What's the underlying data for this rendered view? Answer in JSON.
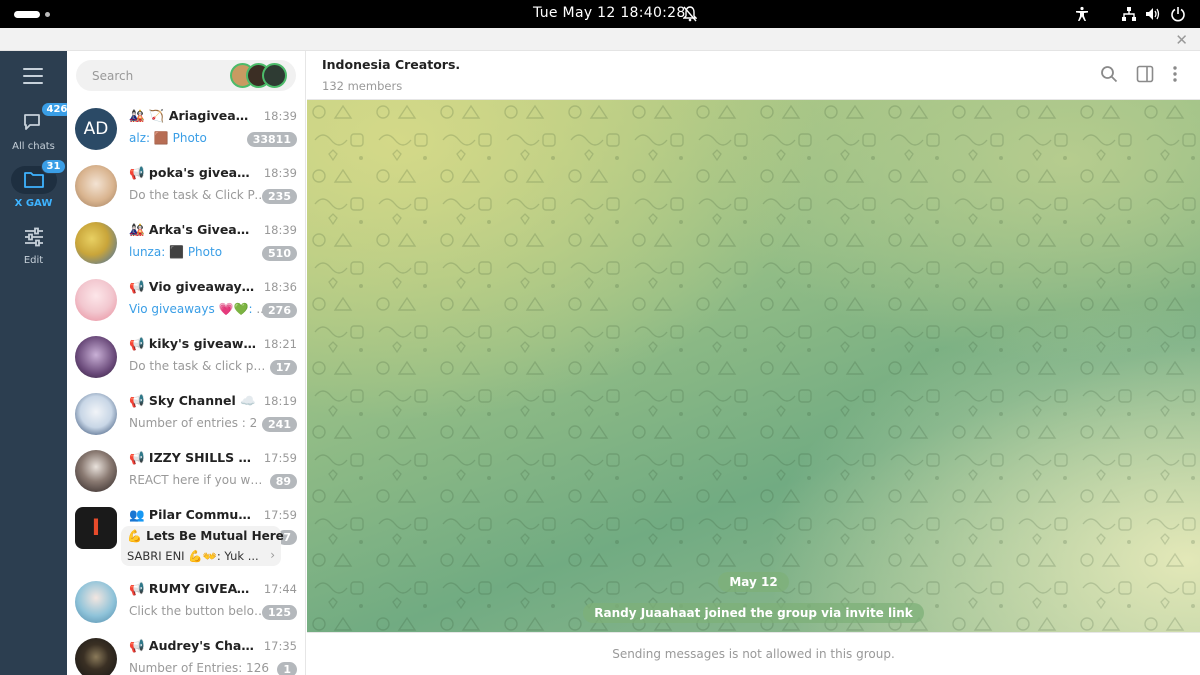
{
  "topbar": {
    "clock": "Tue May 12  18:40:28"
  },
  "rail": {
    "folders": [
      {
        "label": "All chats",
        "badge": "426"
      },
      {
        "label": "X GAW",
        "badge": "31"
      },
      {
        "label": "Edit",
        "badge": ""
      }
    ]
  },
  "search": {
    "placeholder": "Search"
  },
  "chats": [
    {
      "name": "🎎 🏹 Ariagiveaways...",
      "time": "18:39",
      "from": "alz:",
      "preview": " 🟫 Photo",
      "count": "33811",
      "avatar_text": "AD",
      "avatar_color": "#2b4a66"
    },
    {
      "name": "📢 poka's giveaway...",
      "time": "18:39",
      "from": "",
      "preview": "Do the task & Click Pa...",
      "count": "235",
      "avatar_text": "",
      "avatar_color": "#d9b48f"
    },
    {
      "name": "🎎 Arka's Giveaways ...",
      "time": "18:39",
      "from": "lunza:",
      "preview": " ⬛ Photo",
      "count": "510",
      "avatar_text": "",
      "avatar_color": "#c9a53a"
    },
    {
      "name": "📢 Vio giveaways 💗...",
      "time": "18:36",
      "from": "Vio giveaways 💗💚:",
      "preview": " ...",
      "count": "276",
      "avatar_text": "",
      "avatar_color": "#f2c7cf"
    },
    {
      "name": "📢 kiky's giveaways 🐕",
      "time": "18:21",
      "from": "",
      "preview": "Do the task & click parti...",
      "count": "17",
      "avatar_text": "",
      "avatar_color": "#6a4a7a"
    },
    {
      "name": "📢 Sky Channel ☁️",
      "time": "18:19",
      "from": "",
      "preview": "Number of entries : 2",
      "count": "241",
      "avatar_text": "",
      "avatar_color": "#7fa6c9"
    },
    {
      "name": "📢 IZZY SHILLS 🌸 🧚",
      "time": "17:59",
      "from": "",
      "preview": "REACT here if you want ...",
      "count": "89",
      "avatar_text": "",
      "avatar_color": "#3b3333"
    },
    {
      "name": "👥 Pilar Community",
      "time": "17:59",
      "from": "",
      "preview": "",
      "count": "7",
      "avatar_text": "I",
      "avatar_color": "#1a1a1a"
    },
    {
      "name": "📢 RUMY GIVEAWAYS...",
      "time": "17:44",
      "from": "",
      "preview": "Click the button below ...",
      "count": "125",
      "avatar_text": "",
      "avatar_color": "#8fc3d9"
    },
    {
      "name": "📢 Audrey's Channel ...",
      "time": "17:35",
      "from": "",
      "preview": "Number of Entries: 126",
      "count": "1",
      "avatar_text": "",
      "avatar_color": "#141414"
    }
  ],
  "pilar_topic": {
    "title": "💪 Lets Be Mutual Here",
    "preview": "SABRI ENI 💪👐: Yuk ..."
  },
  "header": {
    "title": "Indonesia Creators.",
    "subtitle": "132 members"
  },
  "service": {
    "date": "May 12",
    "join": "Randy Juaahaat joined the group via invite link"
  },
  "footer": {
    "notice": "Sending messages is not allowed in this group."
  },
  "colors": {
    "rail": "#2c3e50",
    "accent": "#3a9ee6",
    "service_bg": "#7eb078"
  }
}
